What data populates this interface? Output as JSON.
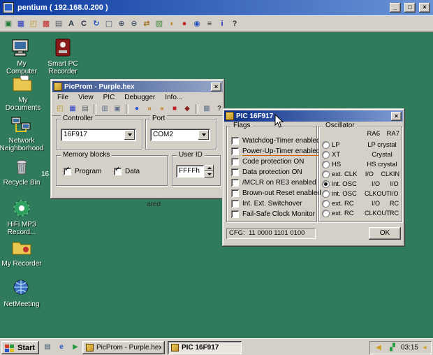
{
  "colors": {
    "desktop_background": "#2f7b5c",
    "window_chrome": "#d4d0c8",
    "viewer_title_gradient": [
      "#0c3aa0",
      "#6b94d6"
    ],
    "active_title_gradient": [
      "#0b2f86",
      "#7e9bd2"
    ],
    "inactive_title_gradient": [
      "#33508e",
      "#97a8c9"
    ],
    "highlight_underline": "#d06000"
  },
  "viewer": {
    "title": "pentium ( 192.168.0.200 )",
    "buttons": {
      "minimize": "_",
      "maximize": "□",
      "close": "×"
    },
    "address": "192.168.0.200",
    "toolbar_icons": [
      {
        "name": "new-connection-icon",
        "glyph": "▣"
      },
      {
        "name": "save-connection-icon",
        "glyph": "▦"
      },
      {
        "name": "open-connection-icon",
        "glyph": "◰"
      },
      {
        "name": "ctrl-alt-del-icon",
        "glyph": "▩"
      },
      {
        "name": "ctrl-esc-icon",
        "glyph": "▤"
      },
      {
        "name": "alt-key-icon",
        "glyph": "A"
      },
      {
        "name": "ctrl-key-icon",
        "glyph": "C"
      },
      {
        "name": "refresh-icon",
        "glyph": "↻"
      },
      {
        "name": "fullscreen-icon",
        "glyph": "▢"
      },
      {
        "name": "zoom-in-icon",
        "glyph": "⊕"
      },
      {
        "name": "zoom-out-icon",
        "glyph": "⊖"
      },
      {
        "name": "file-transfer-icon",
        "glyph": "⇄"
      },
      {
        "name": "clipboard-icon",
        "glyph": "▧"
      },
      {
        "name": "chat-icon",
        "glyph": "◗"
      },
      {
        "name": "record-icon",
        "glyph": "●"
      },
      {
        "name": "snapshot-icon",
        "glyph": "◉"
      },
      {
        "name": "settings-icon",
        "glyph": "≡"
      },
      {
        "name": "info-icon",
        "glyph": "i"
      },
      {
        "name": "help-icon",
        "glyph": "?"
      }
    ]
  },
  "desktop": {
    "icons": [
      {
        "name": "my-computer",
        "label": "My Computer"
      },
      {
        "name": "smart-pc-recorder",
        "label": "Smart PC Recorder"
      },
      {
        "name": "my-documents",
        "label": "My Documents"
      },
      {
        "name": "network-neighborhood",
        "label": "Network Neighborhood"
      },
      {
        "name": "recycle-bin",
        "label": "Recycle Bin"
      },
      {
        "name": "hifi-mp3-recorder",
        "label": "HiFi MP3 Record..."
      },
      {
        "name": "my-recorder",
        "label": "My Recorder"
      },
      {
        "name": "netmeeting",
        "label": "NetMeeting"
      }
    ],
    "fragments": [
      {
        "text": "16"
      },
      {
        "text": "ared"
      }
    ]
  },
  "picprom": {
    "title": "PicProm - Purple.hex",
    "close": "×",
    "menu": [
      "File",
      "View",
      "PIC",
      "Debugger",
      "Info..."
    ],
    "toolbar_icons": [
      {
        "name": "open-file-icon",
        "glyph": "◰"
      },
      {
        "name": "save-file-icon",
        "glyph": "▦"
      },
      {
        "name": "print-icon",
        "glyph": "▤"
      },
      {
        "name": "hex-editor-icon",
        "glyph": "▥"
      },
      {
        "name": "chip-info-icon",
        "glyph": "▣"
      },
      {
        "name": "read-chip-icon",
        "glyph": "●"
      },
      {
        "name": "program-chip-icon",
        "glyph": "»"
      },
      {
        "name": "verify-chip-icon",
        "glyph": "«"
      },
      {
        "name": "stop-icon",
        "glyph": "■"
      },
      {
        "name": "erase-chip-icon",
        "glyph": "◆"
      },
      {
        "name": "config-chip-icon",
        "glyph": "▩"
      },
      {
        "name": "help-icon",
        "glyph": "?"
      }
    ],
    "controller_label": "Controller",
    "controller_value": "16F917",
    "port_label": "Port",
    "port_value": "COM2",
    "memory_label": "Memory blocks",
    "memory_items": [
      {
        "label": "Program",
        "checked": true
      },
      {
        "label": "Data",
        "checked": true
      }
    ],
    "user_id_label": "User ID",
    "user_id_value": "FFFFh"
  },
  "pic_dialog": {
    "title": "PIC 16F917",
    "close": "×",
    "flags_label": "Flags",
    "flags": [
      {
        "label": "Watchdog-Timer enabled",
        "checked": false,
        "underline": false
      },
      {
        "label": "Power-Up-Timer enabled",
        "checked": false,
        "underline": true
      },
      {
        "label": "Code protection ON",
        "checked": false,
        "underline": false
      },
      {
        "label": "Data protection ON",
        "checked": false,
        "underline": false
      },
      {
        "label": "/MCLR on RE3 enabled",
        "checked": false,
        "underline": false
      },
      {
        "label": "Brown-out Reset enabled",
        "checked": false,
        "underline": false
      },
      {
        "label": "Int. Ext. Switchover",
        "checked": false,
        "underline": false
      },
      {
        "label": "Fail-Safe Clock Monitor",
        "checked": false,
        "underline": false
      }
    ],
    "osc_label": "Oscillator",
    "osc_columns": [
      "RA6",
      "RA7"
    ],
    "osc_rows": [
      {
        "name": "LP",
        "desc": "LP crystal",
        "selected": false
      },
      {
        "name": "XT",
        "desc": "Crystal",
        "selected": false
      },
      {
        "name": "HS",
        "desc": "HS crystal",
        "selected": false
      },
      {
        "name": "ext. CLK",
        "ra6": "I/O",
        "ra7": "CLKIN",
        "selected": false
      },
      {
        "name": "int. OSC",
        "ra6": "I/O",
        "ra7": "I/O",
        "selected": true
      },
      {
        "name": "int. OSC",
        "ra6": "CLKOUT",
        "ra7": "I/O",
        "selected": false
      },
      {
        "name": "ext. RC",
        "ra6": "I/O",
        "ra7": "RC",
        "selected": false
      },
      {
        "name": "ext. RC",
        "ra6": "CLKOUT",
        "ra7": "RC",
        "selected": false
      }
    ],
    "cfg": "CFG:  11 0000 1101 0100",
    "ok": "OK"
  },
  "taskbar": {
    "start": "Start",
    "quick_launch": [
      {
        "name": "show-desktop-icon",
        "glyph": "▤"
      },
      {
        "name": "internet-explorer-icon",
        "glyph": "e"
      },
      {
        "name": "media-player-icon",
        "glyph": "▶"
      }
    ],
    "tasks": [
      {
        "label": "PicProm - Purple.hex",
        "active": false
      },
      {
        "label": "PIC 16F917",
        "active": true
      }
    ],
    "tray_icons": [
      {
        "name": "volume-icon",
        "glyph": "◀"
      },
      {
        "name": "network-status-icon",
        "glyph": "▞"
      }
    ],
    "tray_extra": {
      "name": "notification-arrow-icon",
      "glyph": "◂"
    },
    "clock": "03:15"
  }
}
